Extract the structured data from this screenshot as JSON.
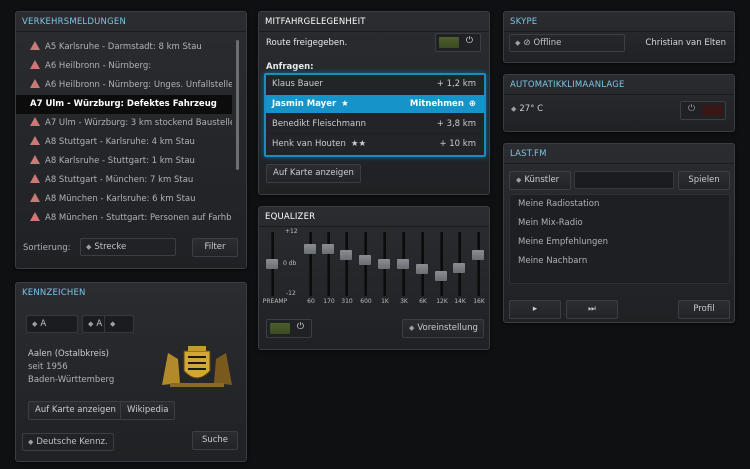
{
  "traffic": {
    "title": "Verkehrsmeldungen",
    "items": [
      {
        "text": "A5 Karlsruhe - Darmstadt: 8 km Stau",
        "active": false
      },
      {
        "text": "A6 Heilbronn - Nürnberg:",
        "active": false
      },
      {
        "text": "A6 Heilbronn - Nürnberg: Unges. Unfallstelle",
        "active": false
      },
      {
        "text": "A7 Ulm - Würzburg: Defektes Fahrzeug",
        "active": true
      },
      {
        "text": "A7 Ulm - Würzburg: 3 km stockend Baustelle",
        "active": false
      },
      {
        "text": "A8 Stuttgart - Karlsruhe: 4 km Stau",
        "active": false
      },
      {
        "text": "A8 Karlsruhe - Stuttgart: 1 km  Stau",
        "active": false
      },
      {
        "text": "A8 Stuttgart - München: 7 km Stau",
        "active": false
      },
      {
        "text": "A8 München - Karlsruhe: 6 km Stau",
        "active": false
      },
      {
        "text": "A8 München - Stuttgart: Personen auf Farhb.",
        "active": false
      }
    ],
    "sort_label": "Sortierung:",
    "sort_value": "Strecke",
    "filter_label": "Filter"
  },
  "plate": {
    "title": "Kennzeichen",
    "fields": [
      "A",
      "A",
      ""
    ],
    "city": "Aalen (Ostalbkreis)",
    "since": "seit 1956",
    "state": "Baden-Württemberg",
    "map_label": "Auf Karte anzeigen",
    "wiki_label": "Wikipedia",
    "type_value": "Deutsche Kennz.",
    "search_label": "Suche"
  },
  "ride": {
    "title": "Mitfahrgelegenheit",
    "share_label": "Route freigegeben.",
    "requests_label": "Anfragen:",
    "requests": [
      {
        "name": "Klaus Bauer",
        "stars": "",
        "right": "+ 1,2 km",
        "selected": false
      },
      {
        "name": "Jasmin Mayer",
        "stars": "★",
        "right": "Mitnehmen",
        "selected": true
      },
      {
        "name": "Benedikt Fleischmann",
        "stars": "",
        "right": "+ 3,8 km",
        "selected": false
      },
      {
        "name": "Henk van Houten",
        "stars": "★★",
        "right": "+ 10 km",
        "selected": false
      }
    ],
    "map_label": "Auf Karte anzeigen"
  },
  "eq": {
    "title": "Equalizer",
    "scale_top": "+12",
    "scale_mid": "0 db",
    "scale_bot": "-12",
    "bands": [
      {
        "label": "PREAMP",
        "level": 0.0
      },
      {
        "label": "60",
        "level": 0.55
      },
      {
        "label": "170",
        "level": 0.55
      },
      {
        "label": "310",
        "level": 0.35
      },
      {
        "label": "600",
        "level": 0.15
      },
      {
        "label": "1K",
        "level": 0.0
      },
      {
        "label": "3K",
        "level": 0.0
      },
      {
        "label": "6K",
        "level": -0.2
      },
      {
        "label": "12K",
        "level": -0.45
      },
      {
        "label": "14K",
        "level": -0.15
      },
      {
        "label": "16K",
        "level": 0.35
      }
    ],
    "preset_label": "Voreinstellung"
  },
  "skype": {
    "title": "Skype",
    "status": "Offline",
    "user": "Christian van Elten"
  },
  "climate": {
    "title": "Automatikklimaanlage",
    "temp": "27° C"
  },
  "lastfm": {
    "title": "Last.fm",
    "mode": "Künstler",
    "play_label": "Spielen",
    "items": [
      "Meine Radiostation",
      "Mein Mix-Radio",
      "Meine Empfehlungen",
      "Meine Nachbarn"
    ],
    "profile_label": "Profil"
  }
}
